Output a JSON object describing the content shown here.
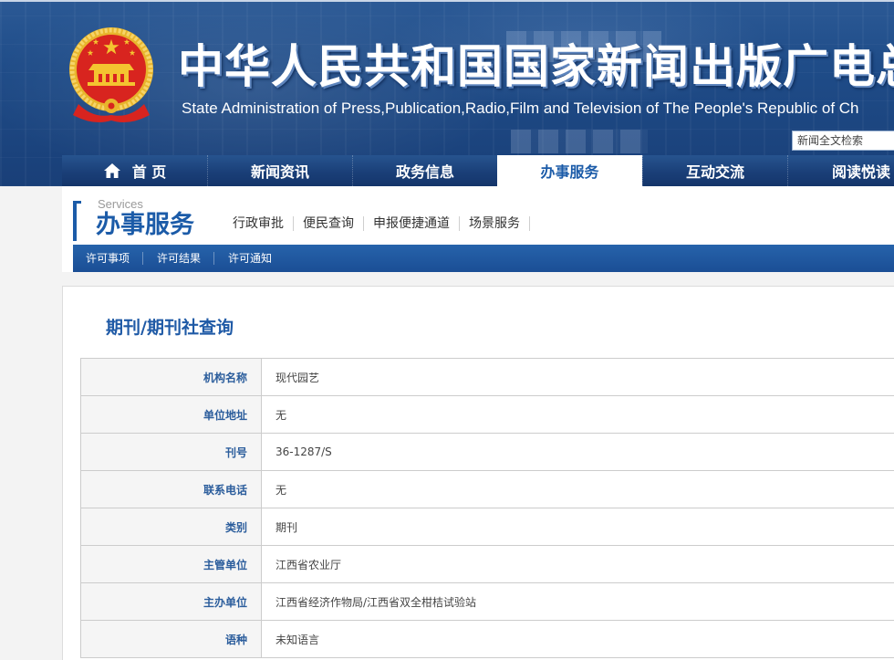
{
  "header": {
    "title": "中华人民共和国国家新闻出版广电总局",
    "subtitle": "State Administration of Press,Publication,Radio,Film and Television of The People's Republic of Ch",
    "search_placeholder": "新闻全文检索",
    "emblem_icon": "national-emblem-icon"
  },
  "nav": {
    "items": [
      {
        "label": "首 页",
        "icon": "home-icon"
      },
      {
        "label": "新闻资讯"
      },
      {
        "label": "政务信息"
      },
      {
        "label": "办事服务",
        "active": true
      },
      {
        "label": "互动交流"
      },
      {
        "label": "阅读悦读"
      }
    ]
  },
  "section": {
    "label_en": "Services",
    "title": "办事服务",
    "links": [
      {
        "label": "行政审批"
      },
      {
        "label": "便民查询"
      },
      {
        "label": "申报便捷通道"
      },
      {
        "label": "场景服务"
      }
    ]
  },
  "subnav": {
    "items": [
      {
        "label": "许可事项"
      },
      {
        "label": "许可结果"
      },
      {
        "label": "许可通知"
      }
    ]
  },
  "content": {
    "title": "期刊/期刊社查询",
    "rows": [
      {
        "label": "机构名称",
        "value": "现代园艺"
      },
      {
        "label": "单位地址",
        "value": "无"
      },
      {
        "label": "刊号",
        "value": "36-1287/S"
      },
      {
        "label": "联系电话",
        "value": "无"
      },
      {
        "label": "类别",
        "value": "期刊"
      },
      {
        "label": "主管单位",
        "value": "江西省农业厅"
      },
      {
        "label": "主办单位",
        "value": "江西省经济作物局/江西省双全柑桔试验站"
      },
      {
        "label": "语种",
        "value": "未知语言"
      }
    ]
  },
  "colors": {
    "banner": "#1f4c88",
    "nav": "#1a3f78",
    "accent": "#1b5ba8",
    "label": "#2b5d9c",
    "sub_bar": "#1e56a0",
    "emblem_red": "#d8241f",
    "emblem_gold": "#e8b52c"
  }
}
